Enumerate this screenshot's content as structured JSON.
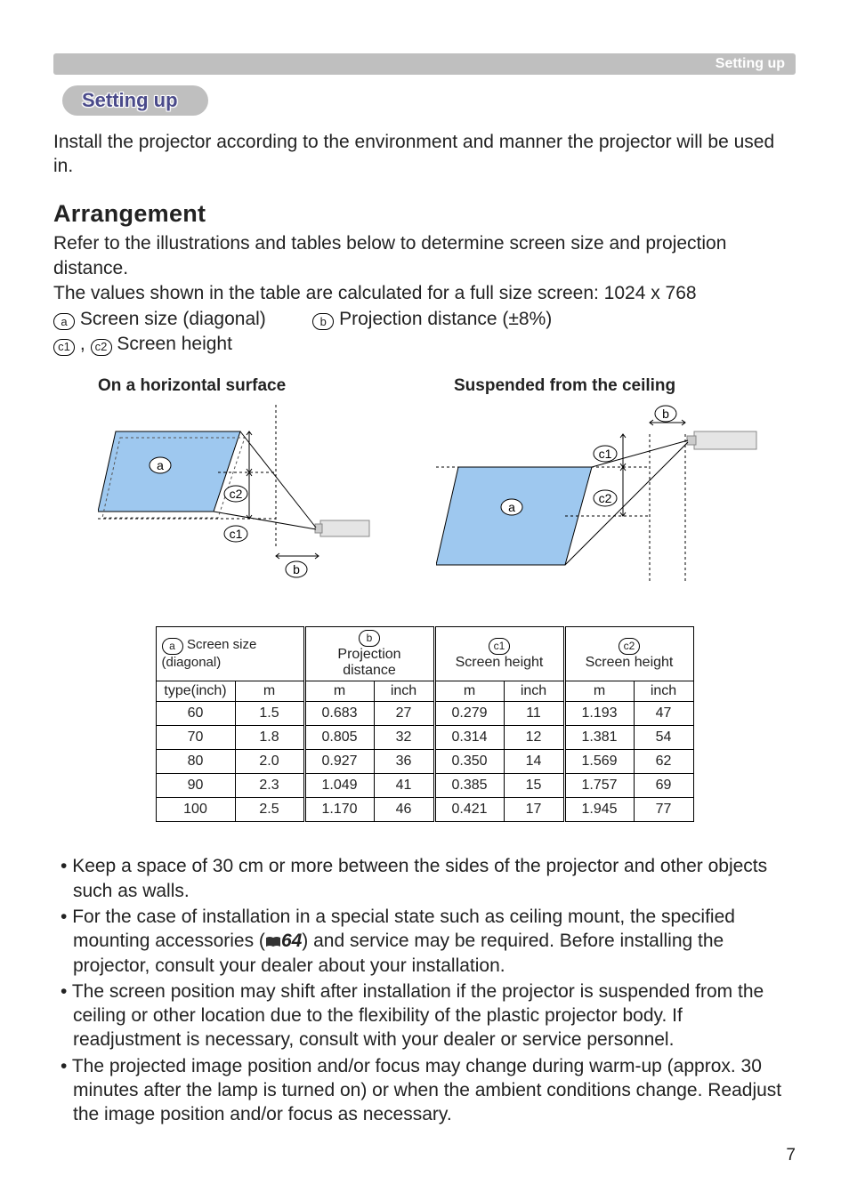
{
  "header": {
    "tab_label": "Setting up"
  },
  "section_pill": "Setting up",
  "intro": "Install the projector according to the environment and manner the projector will be used in.",
  "arrangement": {
    "title": "Arrangement",
    "para1": "Refer to the illustrations and tables below to determine screen size and projection distance.",
    "para2": "The values shown in the table are calculated for a full size screen: 1024 x 768",
    "def_a": " Screen size (diagonal)",
    "def_b": " Projection distance (±8%)",
    "def_c": " Screen height"
  },
  "illus": {
    "left_title": "On a horizontal surface",
    "right_title": "Suspended from the ceiling",
    "a": "a",
    "b": "b",
    "c1": "c1",
    "c2": "c2"
  },
  "table": {
    "col_a": "Screen size (diagonal)",
    "col_b": "Projection distance",
    "col_c1": "Screen height",
    "col_c2": "Screen height",
    "sub_type": "type(inch)",
    "sub_m": "m",
    "sub_inch": "inch"
  },
  "chart_data": {
    "type": "table",
    "columns": [
      "type(inch)",
      "m",
      "b_m",
      "b_inch",
      "c1_m",
      "c1_inch",
      "c2_m",
      "c2_inch"
    ],
    "rows": [
      {
        "type": "60",
        "m": "1.5",
        "b_m": "0.683",
        "b_inch": "27",
        "c1_m": "0.279",
        "c1_inch": "11",
        "c2_m": "1.193",
        "c2_inch": "47"
      },
      {
        "type": "70",
        "m": "1.8",
        "b_m": "0.805",
        "b_inch": "32",
        "c1_m": "0.314",
        "c1_inch": "12",
        "c2_m": "1.381",
        "c2_inch": "54"
      },
      {
        "type": "80",
        "m": "2.0",
        "b_m": "0.927",
        "b_inch": "36",
        "c1_m": "0.350",
        "c1_inch": "14",
        "c2_m": "1.569",
        "c2_inch": "62"
      },
      {
        "type": "90",
        "m": "2.3",
        "b_m": "1.049",
        "b_inch": "41",
        "c1_m": "0.385",
        "c1_inch": "15",
        "c2_m": "1.757",
        "c2_inch": "69"
      },
      {
        "type": "100",
        "m": "2.5",
        "b_m": "1.170",
        "b_inch": "46",
        "c1_m": "0.421",
        "c1_inch": "17",
        "c2_m": "1.945",
        "c2_inch": "77"
      }
    ]
  },
  "bullets": {
    "b1": "Keep a space of 30 cm or more between the sides of the projector and other objects such as walls.",
    "b2a": "For the case of installation in a special state such as ceiling mount, the specified mounting accessories (",
    "b2_ref": "64",
    "b2b": ") and service may be required. Before installing the projector, consult your dealer about your installation.",
    "b3": "The screen position may shift after installation if the projector is suspended from the ceiling or other location due to the flexibility of the plastic projector body. If readjustment is necessary, consult with your dealer or service personnel.",
    "b4": "The projected image position and/or focus may change during warm-up (approx. 30 minutes after the lamp is turned on) or when the ambient conditions change. Readjust the image position and/or focus as necessary."
  },
  "page_number": "7"
}
